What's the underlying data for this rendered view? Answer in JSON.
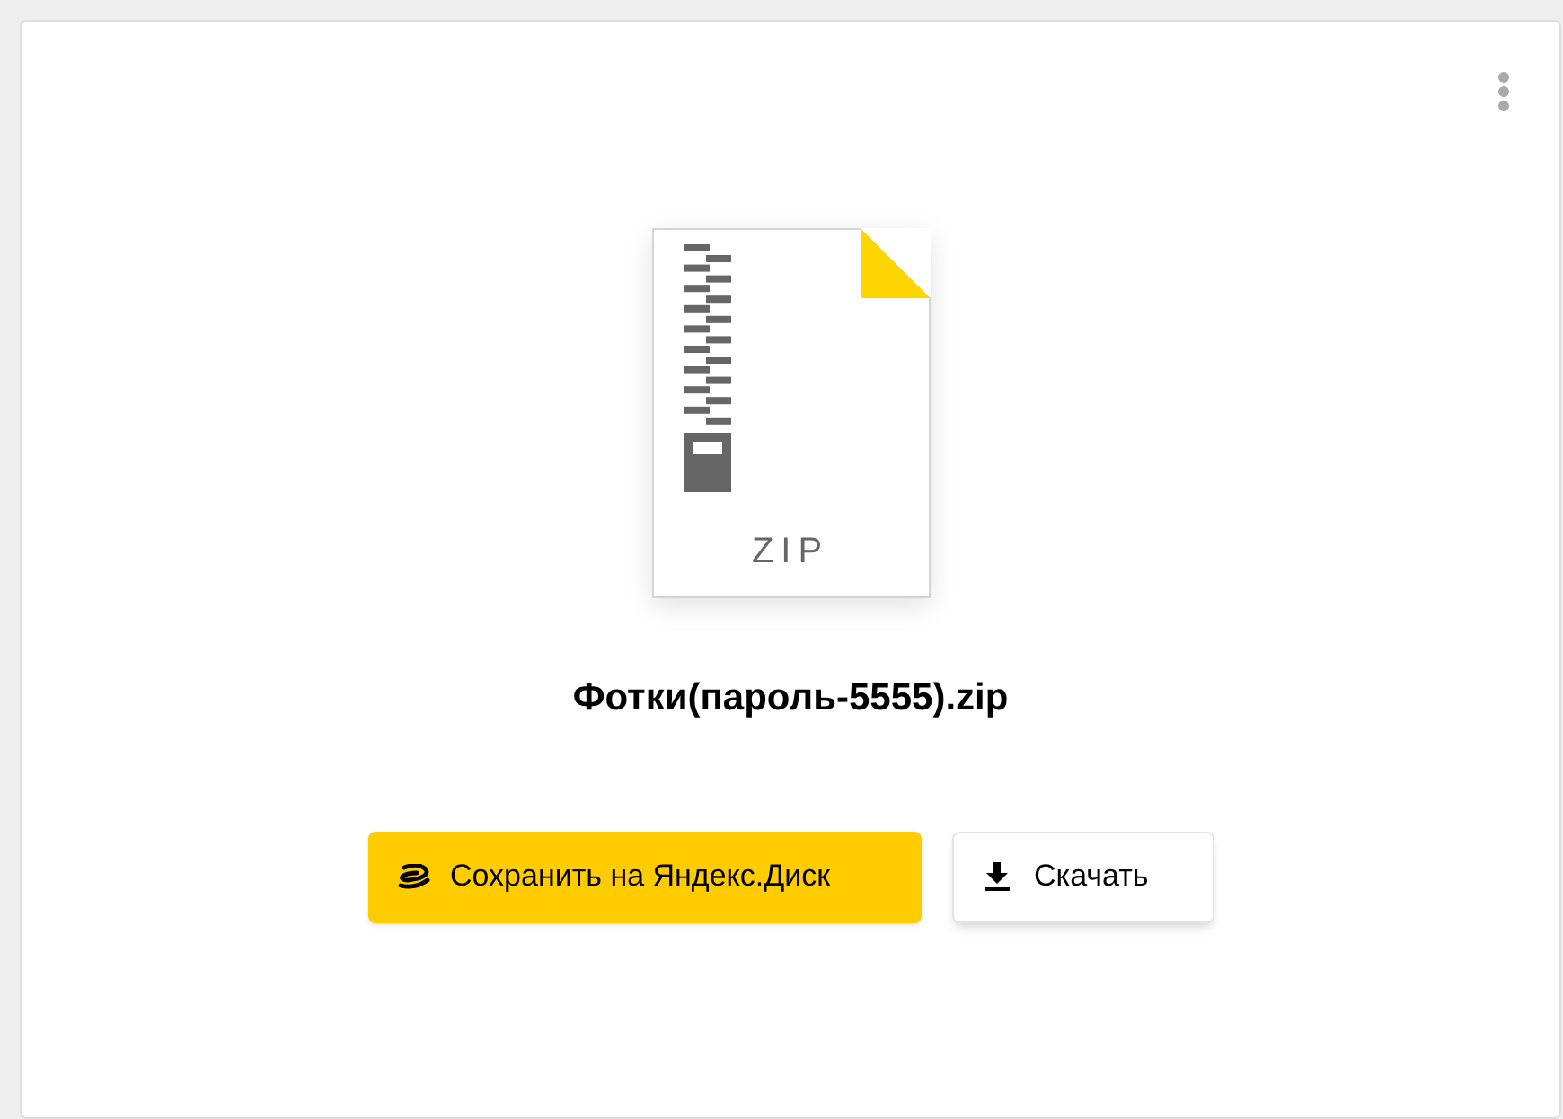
{
  "file": {
    "type_label": "ZIP",
    "name": "Фотки(пароль-5555).zip"
  },
  "buttons": [
    {
      "kind": "save",
      "label": "Сохранить на Яндекс.Диск"
    },
    {
      "kind": "download",
      "label": "Скачать"
    }
  ]
}
